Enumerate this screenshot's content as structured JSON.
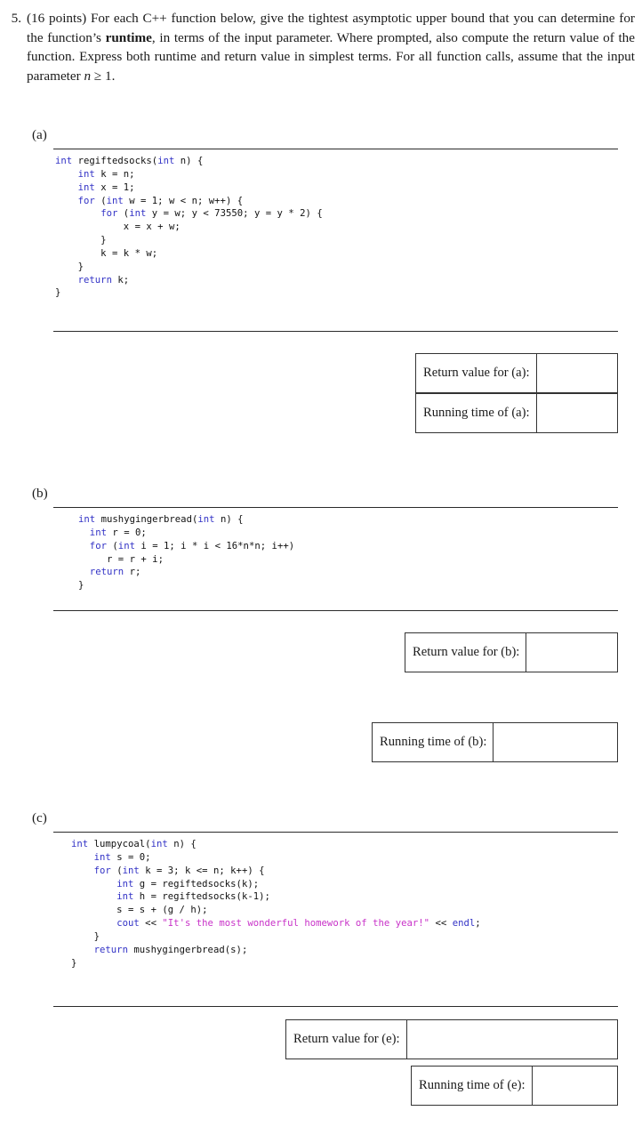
{
  "question": {
    "number": "5.",
    "text_before_bold": "(16 points) For each C++ function below, give the tightest asymptotic upper bound that you can determine for the function’s ",
    "bold_word": "runtime",
    "text_after_bold": ", in terms of the input parameter. Where prompted, also compute the return value of the function. Express both runtime and return value in simplest terms. For all function calls, assume that the input parameter ",
    "math_var": "n",
    "math_rel": " ≥ 1.",
    "full_text": "5. (16 points) For each C++ function below, give the tightest asymptotic upper bound that you can determine for the function’s runtime, in terms of the input parameter. Where prompted, also compute the return value of the function. Express both runtime and return value in simplest terms. For all function calls, assume that the input parameter n ≥ 1."
  },
  "parts": {
    "a": {
      "label": "(a)",
      "code_lines": [
        "int regiftedsocks(int n) {",
        "    int k = n;",
        "    int x = 1;",
        "    for (int w = 1; w < n; w++) {",
        "        for (int y = w; y < 73550; y = y * 2) {",
        "            x = x + w;",
        "        }",
        "        k = k * w;",
        "    }",
        "    return k;",
        "}"
      ],
      "boxes": [
        {
          "label": "Return value for (a):",
          "value": ""
        },
        {
          "label": "Running time of (a):",
          "value": ""
        }
      ]
    },
    "b": {
      "label": "(b)",
      "code_lines": [
        "int mushygingerbread(int n) {",
        "  int r = 0;",
        "  for (int i = 1; i * i < 16*n*n; i++)",
        "     r = r + i;",
        "  return r;",
        "}"
      ],
      "boxes": [
        {
          "label": "Return value for (b):",
          "value": ""
        },
        {
          "label": "Running time of (b):",
          "value": ""
        }
      ]
    },
    "c": {
      "label": "(c)",
      "code_lines": [
        "int lumpycoal(int n) {",
        "    int s = 0;",
        "    for (int k = 3; k <= n; k++) {",
        "        int g = regiftedsocks(k);",
        "        int h = regiftedsocks(k-1);",
        "        s = s + (g / h);",
        "        cout << \"It's the most wonderful homework of the year!\" << endl;",
        "    }",
        "    return mushygingerbread(s);",
        "}"
      ],
      "boxes": [
        {
          "label": "Return value for (e):",
          "value": ""
        },
        {
          "label": "Running time of (e):",
          "value": ""
        }
      ]
    }
  },
  "colors": {
    "keyword": "#3333c6",
    "string": "#c832c8",
    "text": "#1a1a1a",
    "rule": "#2b2b2b",
    "box_border": "#333333"
  }
}
